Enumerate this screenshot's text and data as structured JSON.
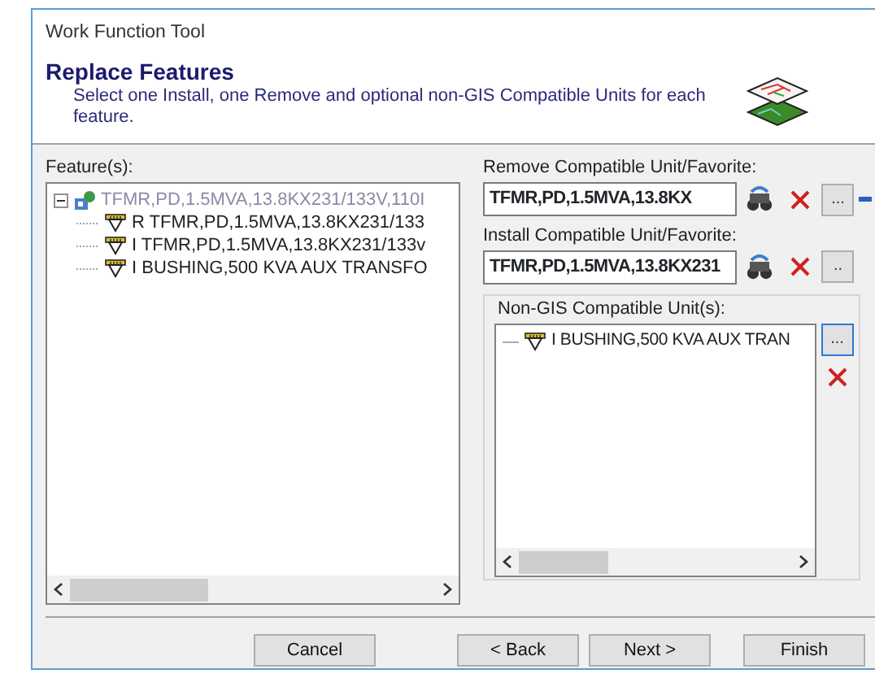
{
  "window": {
    "title": "Work Function Tool"
  },
  "header": {
    "heading": "Replace Features",
    "description": "Select one Install, one Remove and optional non-GIS Compatible Units for each feature."
  },
  "features": {
    "label": "Feature(s):",
    "tree": [
      {
        "text": "TFMR,PD,1.5MVA,13.8KX231/133V,110I",
        "expanded": true,
        "children": [
          {
            "text": "R TFMR,PD,1.5MVA,13.8KX231/133"
          },
          {
            "text": "I TFMR,PD,1.5MVA,13.8KX231/133v"
          },
          {
            "text": "I BUSHING,500 KVA AUX TRANSFO"
          }
        ]
      }
    ]
  },
  "remove": {
    "label": "Remove Compatible Unit/Favorite:",
    "value": "TFMR,PD,1.5MVA,13.8KX",
    "browse": "..."
  },
  "install": {
    "label": "Install Compatible Unit/Favorite:",
    "value": "TFMR,PD,1.5MVA,13.8KX231",
    "browse": ".."
  },
  "non_gis": {
    "label": "Non-GIS Compatible Unit(s):",
    "items": [
      "I BUSHING,500 KVA AUX TRAN"
    ],
    "add": "..."
  },
  "buttons": [
    {
      "label": "Cancel"
    },
    {
      "label": "< Back"
    },
    {
      "label": "Next >"
    },
    {
      "label": "Finish"
    }
  ]
}
